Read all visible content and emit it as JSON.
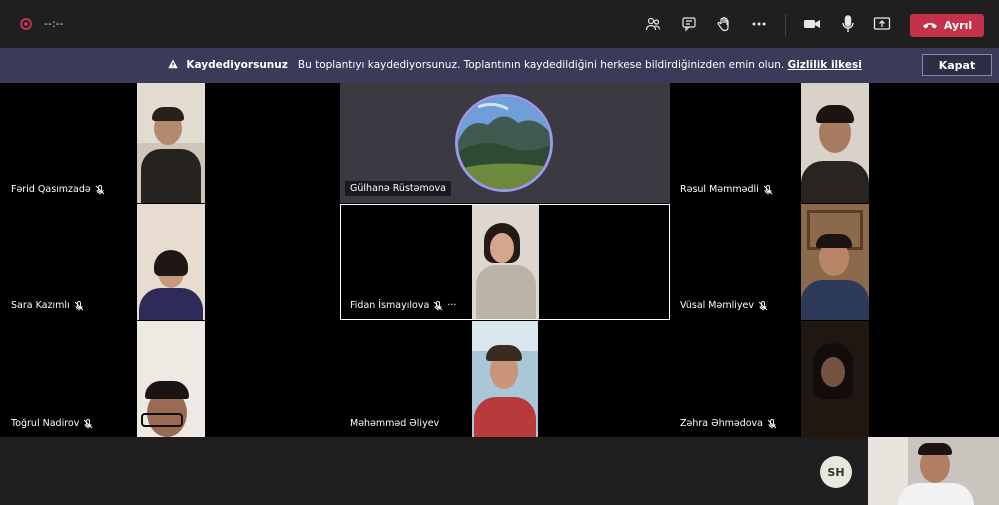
{
  "toolbar": {
    "timer": "--:--",
    "leave_label": "Ayrıl",
    "icons": [
      "participants-icon",
      "chat-icon",
      "raise-hand-icon",
      "more-icon",
      "camera-icon",
      "mic-icon",
      "share-icon",
      "hangup-icon"
    ]
  },
  "banner": {
    "title": "Kaydediyorsunuz",
    "message": "Bu toplantıyı kaydediyorsunuz. Toplantının kaydedildiğini herkese bildirdiğinizden emin olun.",
    "link": "Gizlilik ilkesi",
    "close_label": "Kapat"
  },
  "participants": {
    "left": [
      "Fərid Qasımzadə",
      "Sara Kazımlı",
      "Toğrul Nadirov"
    ],
    "center": [
      "Gülhanə Rüstəmova",
      "Fidan İsmayılova",
      "Məhəmməd Əliyev"
    ],
    "right": [
      "Rəsul Məmmədli",
      "Vüsal Məmliyev",
      "Zəhra Əhmədova"
    ],
    "more": "···"
  },
  "self": {
    "initials": "SH"
  },
  "colors": {
    "accent": "#9c97e6",
    "leave": "#c4314b",
    "banner": "#3a3b59",
    "bar": "#1f1f1f"
  }
}
